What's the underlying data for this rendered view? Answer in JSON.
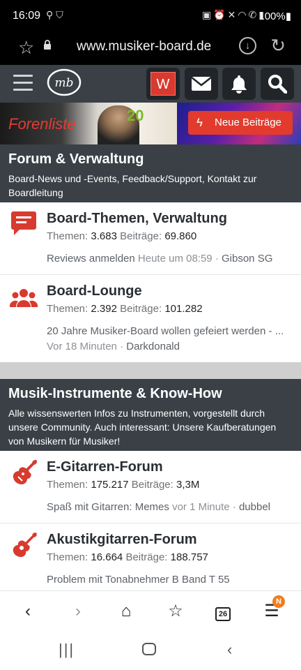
{
  "status_bar": {
    "time": "16:09",
    "battery": "100%",
    "left_icons": [
      "walking-icon",
      "shield-icon"
    ],
    "right_icons": [
      "nfc-icon",
      "alarm-icon",
      "mute-icon",
      "wifi-icon",
      "wifi-call-icon",
      "signal-icon"
    ]
  },
  "browser": {
    "url": "www.musiker-board.de"
  },
  "site_header": {
    "logo_text": "mb",
    "user_button_label": "W"
  },
  "banner": {
    "forenliste_label": "Forenliste",
    "anniversary_label": "20",
    "new_posts_label": "Neue Beiträge"
  },
  "categories": [
    {
      "title": "Forum & Verwaltung",
      "description": "Board-News und -Events, Feedback/Support, Kontakt zur Boardleitung",
      "forums": [
        {
          "icon": "chat-icon",
          "name": "Board-Themen, Verwaltung",
          "threads_label": "Themen:",
          "threads": "3.683",
          "posts_label": "Beiträge:",
          "posts": "69.860",
          "last_thread": "Reviews anmelden",
          "last_time": "Heute um 08:59",
          "last_user": "Gibson SG"
        },
        {
          "icon": "users-icon",
          "name": "Board-Lounge",
          "threads_label": "Themen:",
          "threads": "2.392",
          "posts_label": "Beiträge:",
          "posts": "101.282",
          "last_thread": "20 Jahre Musiker-Board wollen gefeiert werden - ...",
          "last_time": "Vor 18 Minuten",
          "last_user": "Darkdonald"
        }
      ]
    },
    {
      "title": "Musik-Instrumente & Know-How",
      "description": "Alle wissenswerten Infos zu Instrumenten, vorgestellt durch unsere Community. Auch interessant: Unsere Kaufberatungen von Musikern für Musiker!",
      "forums": [
        {
          "icon": "electric-guitar-icon",
          "name": "E-Gitarren-Forum",
          "threads_label": "Themen:",
          "threads": "175.217",
          "posts_label": "Beiträge:",
          "posts": "3,3M",
          "last_thread": "Spaß mit Gitarren: Memes",
          "last_time": "vor 1 Minute",
          "last_user": "dubbel"
        },
        {
          "icon": "acoustic-guitar-icon",
          "name": "Akustikgitarren-Forum",
          "threads_label": "Themen:",
          "threads": "16.664",
          "posts_label": "Beiträge:",
          "posts": "188.757",
          "last_thread": "Problem mit Tonabnehmer B Band T 55"
        }
      ]
    }
  ],
  "toolbar": {
    "tab_count": "26",
    "menu_badge": "N"
  },
  "colors": {
    "header_bg": "#3a4046",
    "accent_red": "#d83a2f",
    "badge_orange": "#f07d1e"
  }
}
